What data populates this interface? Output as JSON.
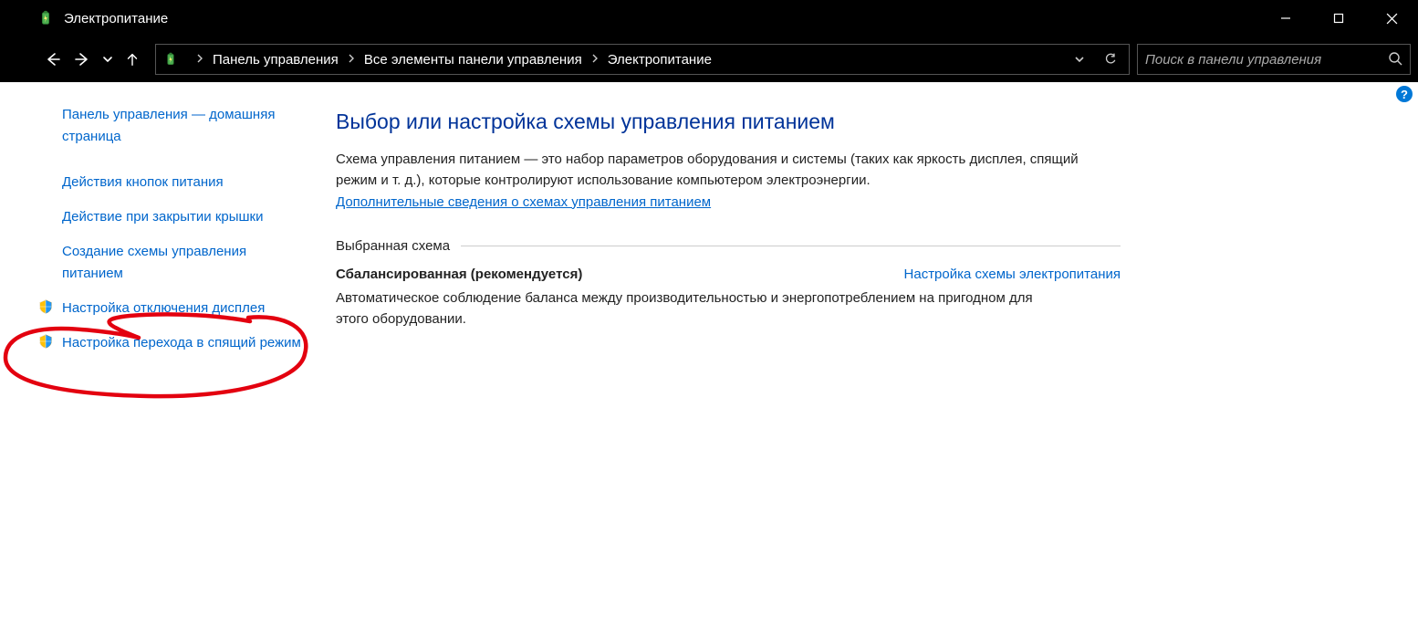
{
  "window": {
    "title": "Электропитание"
  },
  "breadcrumbs": {
    "0": "Панель управления",
    "1": "Все элементы панели управления",
    "2": "Электропитание"
  },
  "search": {
    "placeholder": "Поиск в панели управления"
  },
  "sidebar": {
    "home": "Панель управления — домашняя страница",
    "buttons": "Действия кнопок питания",
    "lid": "Действие при закрытии крышки",
    "create": "Создание схемы управления питанием",
    "display": "Настройка отключения дисплея",
    "sleep": "Настройка перехода в спящий режим"
  },
  "main": {
    "heading": "Выбор или настройка схемы управления питанием",
    "desc": "Схема управления питанием — это набор параметров оборудования и системы (таких как яркость дисплея, спящий режим и т. д.), которые контролируют использование компьютером электроэнергии.",
    "learn_more": "Дополнительные сведения о схемах управления питанием",
    "section_label": "Выбранная схема",
    "plan_name": "Сбалансированная (рекомендуется)",
    "plan_link": "Настройка схемы электропитания",
    "plan_desc": "Автоматическое соблюдение баланса между производительностью и энергопотреблением на пригодном для этого оборудовании."
  },
  "help": {
    "tip": "?"
  }
}
